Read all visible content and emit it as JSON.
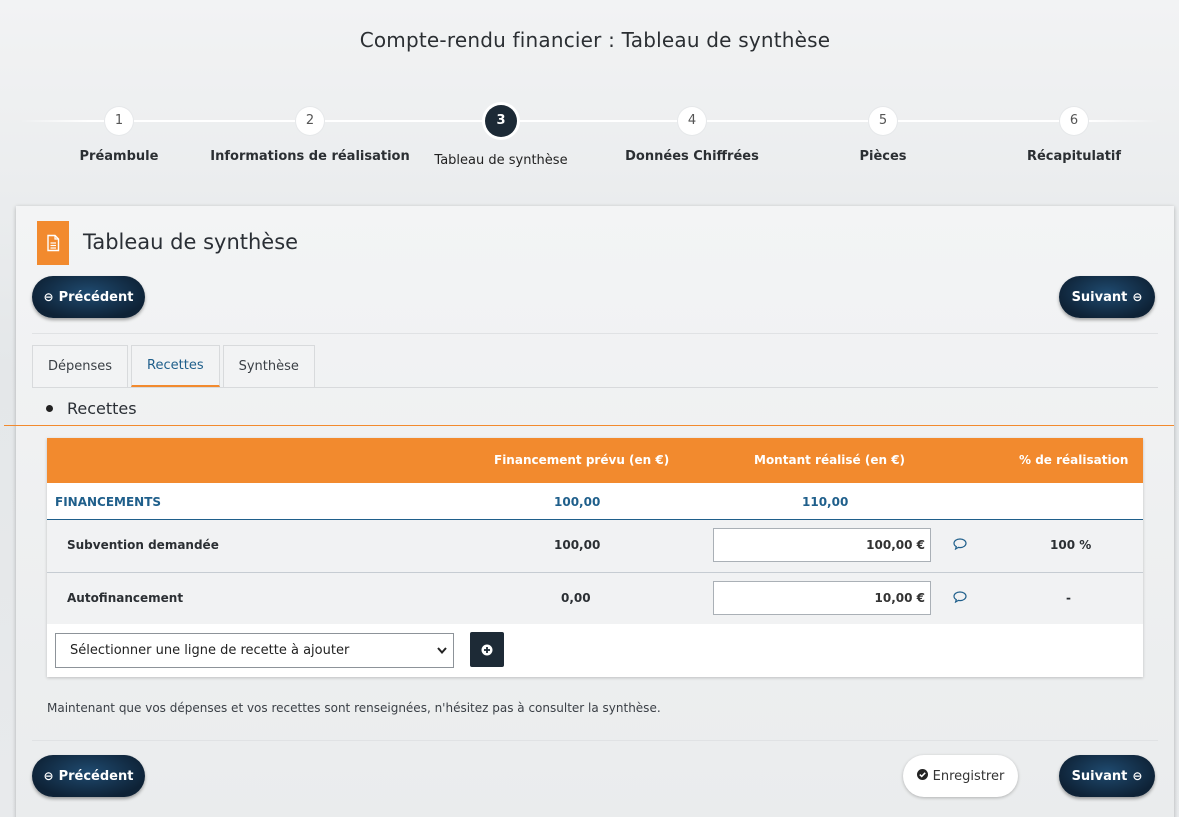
{
  "page": {
    "title": "Compte-rendu financier : Tableau de synthèse"
  },
  "stepper": {
    "steps": [
      {
        "number": "1",
        "label": "Préambule"
      },
      {
        "number": "2",
        "label": "Informations de réalisation"
      },
      {
        "number": "3",
        "label": "Tableau de synthèse"
      },
      {
        "number": "4",
        "label": "Données Chiffrées"
      },
      {
        "number": "5",
        "label": "Pièces"
      },
      {
        "number": "6",
        "label": "Récapitulatif"
      }
    ],
    "active_step": "3"
  },
  "card": {
    "title": "Tableau de synthèse",
    "icon": "document-icon",
    "accent_color": "#f28a2e"
  },
  "nav": {
    "previous_label": "Précédent",
    "next_label": "Suivant",
    "save_label": "Enregistrer"
  },
  "tabs": [
    {
      "label": "Dépenses"
    },
    {
      "label": "Recettes",
      "active": true
    },
    {
      "label": "Synthèse"
    }
  ],
  "section": {
    "title": "Recettes"
  },
  "table": {
    "headers": {
      "planned": "Financement prévu (en €)",
      "actual": "Montant réalisé (en €)",
      "percent": "% de réalisation"
    },
    "group": {
      "label": "FINANCEMENTS",
      "planned": "100,00",
      "actual": "110,00"
    },
    "rows": [
      {
        "label": "Subvention demandée",
        "planned": "100,00",
        "actual": "100,00 €",
        "percent": "100 %"
      },
      {
        "label": "Autofinancement",
        "planned": "0,00",
        "actual": "10,00 €",
        "percent": "-"
      }
    ],
    "add_select": {
      "selected": "Sélectionner une ligne de recette à ajouter"
    }
  },
  "note": "Maintenant que vos dépenses et vos recettes sont renseignées, n'hésitez pas à consulter la synthèse.",
  "colors": {
    "orange": "#f28a2e",
    "navy": "#0e2236",
    "link_blue": "#1f5f8b"
  }
}
